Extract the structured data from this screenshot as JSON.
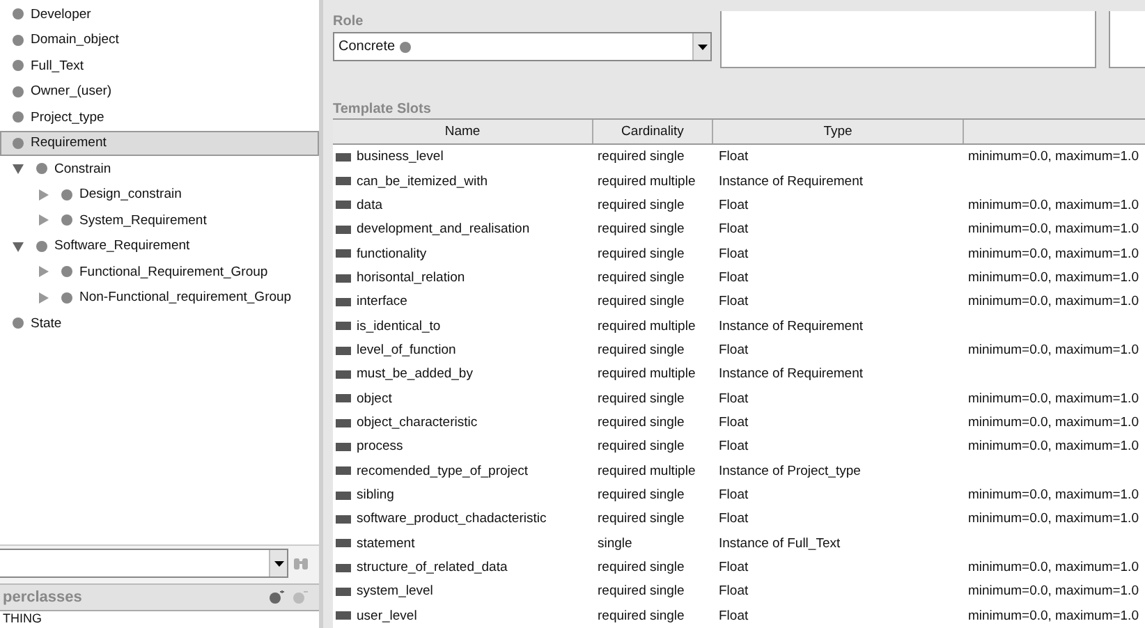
{
  "class_tree": [
    {
      "label": "Developer",
      "selected": false
    },
    {
      "label": "Domain_object",
      "selected": false
    },
    {
      "label": "Full_Text",
      "selected": false
    },
    {
      "label": "Owner_(user)",
      "selected": false
    },
    {
      "label": "Project_type",
      "selected": false
    },
    {
      "label": "Requirement",
      "selected": true,
      "children": [
        {
          "label": "Constrain",
          "selected": false,
          "expanded": true,
          "children": [
            {
              "label": "Design_constrain",
              "selected": false,
              "expanded": false
            },
            {
              "label": "System_Requirement",
              "selected": false,
              "expanded": false
            }
          ]
        },
        {
          "label": "Software_Requirement",
          "selected": false,
          "expanded": true,
          "children": [
            {
              "label": "Functional_Requirement_Group",
              "selected": false,
              "expanded": false
            },
            {
              "label": "Non-Functional_requirement_Group",
              "selected": false,
              "expanded": false
            }
          ]
        }
      ]
    },
    {
      "label": "State",
      "selected": false
    }
  ],
  "superclasses": {
    "title": "perclasses",
    "items": [
      "THING"
    ]
  },
  "role": {
    "label": "Role",
    "value": "Concrete"
  },
  "template_slots": {
    "title": "Template Slots",
    "columns": [
      "Name",
      "Cardinality",
      "Type"
    ],
    "rows": [
      {
        "name": "business_level",
        "cardinality": "required single",
        "type": "Float",
        "column_4": "minimum=0.0, maximum=1.0"
      },
      {
        "name": "can_be_itemized_with",
        "cardinality": "required multiple",
        "type": "Instance of Requirement"
      },
      {
        "name": "data",
        "cardinality": "required single",
        "type": "Float",
        "column_4": "minimum=0.0, maximum=1.0"
      },
      {
        "name": "development_and_realisation",
        "cardinality": "required single",
        "type": "Float",
        "column_4": "minimum=0.0, maximum=1.0"
      },
      {
        "name": "functionality",
        "cardinality": "required single",
        "type": "Float",
        "column_4": "minimum=0.0, maximum=1.0"
      },
      {
        "name": "horisontal_relation",
        "cardinality": "required single",
        "type": "Float",
        "column_4": "minimum=0.0, maximum=1.0"
      },
      {
        "name": "interface",
        "cardinality": "required single",
        "type": "Float",
        "column_4": "minimum=0.0, maximum=1.0"
      },
      {
        "name": "is_identical_to",
        "cardinality": "required multiple",
        "type": "Instance of Requirement"
      },
      {
        "name": "level_of_function",
        "cardinality": "required single",
        "type": "Float",
        "column_4": "minimum=0.0, maximum=1.0"
      },
      {
        "name": "must_be_added_by",
        "cardinality": "required multiple",
        "type": "Instance of Requirement"
      },
      {
        "name": "object",
        "cardinality": "required single",
        "type": "Float",
        "column_4": "minimum=0.0, maximum=1.0"
      },
      {
        "name": "object_characteristic",
        "cardinality": "required single",
        "type": "Float",
        "column_4": "minimum=0.0, maximum=1.0"
      },
      {
        "name": "process",
        "cardinality": "required single",
        "type": "Float",
        "column_4": "minimum=0.0, maximum=1.0"
      },
      {
        "name": "recomended_type_of_project",
        "cardinality": "required multiple",
        "type": "Instance of Project_type"
      },
      {
        "name": "sibling",
        "cardinality": "required single",
        "type": "Float",
        "column_4": "minimum=0.0, maximum=1.0"
      },
      {
        "name": "software_product_chadacteristic",
        "cardinality": "required single",
        "type": "Float",
        "column_4": "minimum=0.0, maximum=1.0"
      },
      {
        "name": "statement",
        "cardinality": "single",
        "type": "Instance of Full_Text"
      },
      {
        "name": "structure_of_related_data",
        "cardinality": "required single",
        "type": "Float",
        "column_4": "minimum=0.0, maximum=1.0"
      },
      {
        "name": "system_level",
        "cardinality": "required single",
        "type": "Float",
        "column_4": "minimum=0.0, maximum=1.0"
      },
      {
        "name": "user_level",
        "cardinality": "required single",
        "type": "Float",
        "column_4": "minimum=0.0, maximum=1.0"
      }
    ]
  }
}
